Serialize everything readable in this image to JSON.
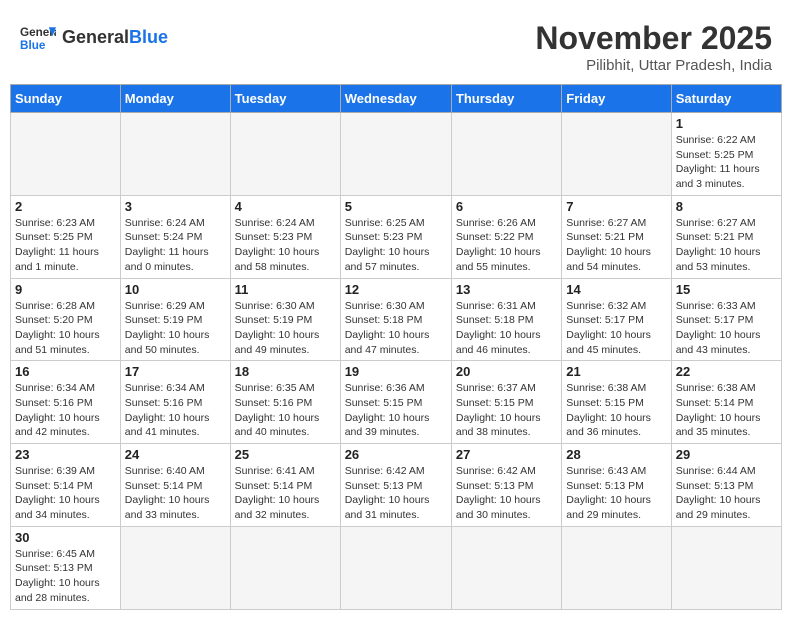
{
  "header": {
    "logo_general": "General",
    "logo_blue": "Blue",
    "month_title": "November 2025",
    "location": "Pilibhit, Uttar Pradesh, India"
  },
  "days_of_week": [
    "Sunday",
    "Monday",
    "Tuesday",
    "Wednesday",
    "Thursday",
    "Friday",
    "Saturday"
  ],
  "weeks": [
    [
      {
        "day": "",
        "info": ""
      },
      {
        "day": "",
        "info": ""
      },
      {
        "day": "",
        "info": ""
      },
      {
        "day": "",
        "info": ""
      },
      {
        "day": "",
        "info": ""
      },
      {
        "day": "",
        "info": ""
      },
      {
        "day": "1",
        "info": "Sunrise: 6:22 AM\nSunset: 5:25 PM\nDaylight: 11 hours\nand 3 minutes."
      }
    ],
    [
      {
        "day": "2",
        "info": "Sunrise: 6:23 AM\nSunset: 5:25 PM\nDaylight: 11 hours\nand 1 minute."
      },
      {
        "day": "3",
        "info": "Sunrise: 6:24 AM\nSunset: 5:24 PM\nDaylight: 11 hours\nand 0 minutes."
      },
      {
        "day": "4",
        "info": "Sunrise: 6:24 AM\nSunset: 5:23 PM\nDaylight: 10 hours\nand 58 minutes."
      },
      {
        "day": "5",
        "info": "Sunrise: 6:25 AM\nSunset: 5:23 PM\nDaylight: 10 hours\nand 57 minutes."
      },
      {
        "day": "6",
        "info": "Sunrise: 6:26 AM\nSunset: 5:22 PM\nDaylight: 10 hours\nand 55 minutes."
      },
      {
        "day": "7",
        "info": "Sunrise: 6:27 AM\nSunset: 5:21 PM\nDaylight: 10 hours\nand 54 minutes."
      },
      {
        "day": "8",
        "info": "Sunrise: 6:27 AM\nSunset: 5:21 PM\nDaylight: 10 hours\nand 53 minutes."
      }
    ],
    [
      {
        "day": "9",
        "info": "Sunrise: 6:28 AM\nSunset: 5:20 PM\nDaylight: 10 hours\nand 51 minutes."
      },
      {
        "day": "10",
        "info": "Sunrise: 6:29 AM\nSunset: 5:19 PM\nDaylight: 10 hours\nand 50 minutes."
      },
      {
        "day": "11",
        "info": "Sunrise: 6:30 AM\nSunset: 5:19 PM\nDaylight: 10 hours\nand 49 minutes."
      },
      {
        "day": "12",
        "info": "Sunrise: 6:30 AM\nSunset: 5:18 PM\nDaylight: 10 hours\nand 47 minutes."
      },
      {
        "day": "13",
        "info": "Sunrise: 6:31 AM\nSunset: 5:18 PM\nDaylight: 10 hours\nand 46 minutes."
      },
      {
        "day": "14",
        "info": "Sunrise: 6:32 AM\nSunset: 5:17 PM\nDaylight: 10 hours\nand 45 minutes."
      },
      {
        "day": "15",
        "info": "Sunrise: 6:33 AM\nSunset: 5:17 PM\nDaylight: 10 hours\nand 43 minutes."
      }
    ],
    [
      {
        "day": "16",
        "info": "Sunrise: 6:34 AM\nSunset: 5:16 PM\nDaylight: 10 hours\nand 42 minutes."
      },
      {
        "day": "17",
        "info": "Sunrise: 6:34 AM\nSunset: 5:16 PM\nDaylight: 10 hours\nand 41 minutes."
      },
      {
        "day": "18",
        "info": "Sunrise: 6:35 AM\nSunset: 5:16 PM\nDaylight: 10 hours\nand 40 minutes."
      },
      {
        "day": "19",
        "info": "Sunrise: 6:36 AM\nSunset: 5:15 PM\nDaylight: 10 hours\nand 39 minutes."
      },
      {
        "day": "20",
        "info": "Sunrise: 6:37 AM\nSunset: 5:15 PM\nDaylight: 10 hours\nand 38 minutes."
      },
      {
        "day": "21",
        "info": "Sunrise: 6:38 AM\nSunset: 5:15 PM\nDaylight: 10 hours\nand 36 minutes."
      },
      {
        "day": "22",
        "info": "Sunrise: 6:38 AM\nSunset: 5:14 PM\nDaylight: 10 hours\nand 35 minutes."
      }
    ],
    [
      {
        "day": "23",
        "info": "Sunrise: 6:39 AM\nSunset: 5:14 PM\nDaylight: 10 hours\nand 34 minutes."
      },
      {
        "day": "24",
        "info": "Sunrise: 6:40 AM\nSunset: 5:14 PM\nDaylight: 10 hours\nand 33 minutes."
      },
      {
        "day": "25",
        "info": "Sunrise: 6:41 AM\nSunset: 5:14 PM\nDaylight: 10 hours\nand 32 minutes."
      },
      {
        "day": "26",
        "info": "Sunrise: 6:42 AM\nSunset: 5:13 PM\nDaylight: 10 hours\nand 31 minutes."
      },
      {
        "day": "27",
        "info": "Sunrise: 6:42 AM\nSunset: 5:13 PM\nDaylight: 10 hours\nand 30 minutes."
      },
      {
        "day": "28",
        "info": "Sunrise: 6:43 AM\nSunset: 5:13 PM\nDaylight: 10 hours\nand 29 minutes."
      },
      {
        "day": "29",
        "info": "Sunrise: 6:44 AM\nSunset: 5:13 PM\nDaylight: 10 hours\nand 29 minutes."
      }
    ],
    [
      {
        "day": "30",
        "info": "Sunrise: 6:45 AM\nSunset: 5:13 PM\nDaylight: 10 hours\nand 28 minutes."
      },
      {
        "day": "",
        "info": ""
      },
      {
        "day": "",
        "info": ""
      },
      {
        "day": "",
        "info": ""
      },
      {
        "day": "",
        "info": ""
      },
      {
        "day": "",
        "info": ""
      },
      {
        "day": "",
        "info": ""
      }
    ]
  ]
}
